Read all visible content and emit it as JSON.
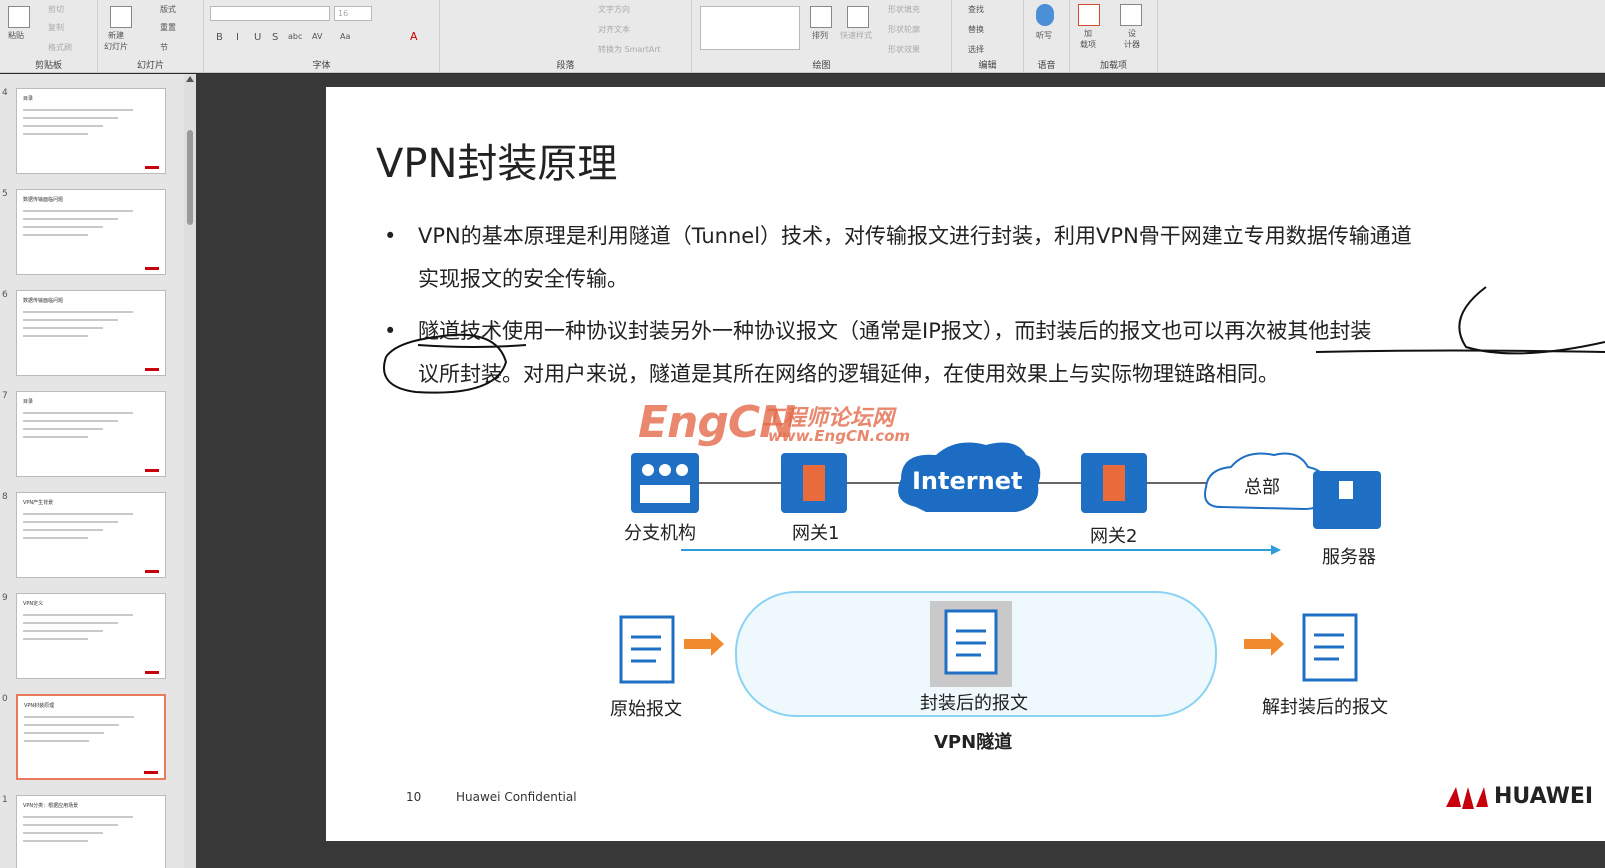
{
  "ribbon": {
    "clipboard": {
      "label": "剪贴板",
      "paste": "粘贴",
      "cut": "剪切",
      "copy": "复制",
      "format_painter": "格式刷"
    },
    "slides": {
      "label": "幻灯片",
      "new_slide": "新建\n幻灯片",
      "layout": "版式",
      "reset": "重置",
      "section": "节"
    },
    "font": {
      "label": "字体",
      "size": "16",
      "bold": "B",
      "italic": "I",
      "underline": "U",
      "strike": "S",
      "shadow": "abc",
      "spacing": "AV",
      "case": "Aa",
      "color": "A"
    },
    "paragraph": {
      "label": "段落",
      "text_direction": "文字方向",
      "align_text": "对齐文本",
      "smartart": "转换为 SmartArt"
    },
    "drawing": {
      "label": "绘图",
      "arrange": "排列",
      "quick_styles": "快速样式",
      "fill": "形状填充",
      "outline": "形状轮廓",
      "effects": "形状效果"
    },
    "editing": {
      "label": "编辑",
      "find": "查找",
      "replace": "替换",
      "select": "选择"
    },
    "voice": {
      "label": "语音",
      "dictate": "听写"
    },
    "addins": {
      "label": "加载项",
      "addin": "加\n载项",
      "designer": "设\n计器"
    }
  },
  "thumbnails": [
    {
      "num": "4",
      "title": "目录"
    },
    {
      "num": "5",
      "title": "数据传输面临问题"
    },
    {
      "num": "6",
      "title": "数据传输面临问题"
    },
    {
      "num": "7",
      "title": "目录"
    },
    {
      "num": "8",
      "title": "VPN产生背景"
    },
    {
      "num": "9",
      "title": "VPN定义"
    },
    {
      "num": "0",
      "title": "VPN封装原理",
      "selected": true
    },
    {
      "num": "1",
      "title": "VPN分类：根据应用场景"
    }
  ],
  "slide": {
    "title": "VPN封装原理",
    "bullets": [
      {
        "line1": "VPN的基本原理是利用隧道（Tunnel）技术，对传输报文进行封装，利用VPN骨干网建立专用数据传输通道",
        "line2": "实现报文的安全传输。"
      },
      {
        "line1": "隧道技术使用一种协议封装另外一种协议报文（通常是IP报文），而封装后的报文也可以再次被其他封装",
        "line2": "议所封装。对用户来说，隧道是其所在网络的逻辑延伸，在使用效果上与实际物理链路相同。"
      }
    ],
    "watermark": {
      "main": "EngCN",
      "cn": "工程师论坛网",
      "url": "www.EngCN.com"
    },
    "diagram": {
      "branch": "分支机构",
      "gw1": "网关1",
      "internet": "Internet",
      "gw2": "网关2",
      "hq": "总部",
      "server": "服务器",
      "original": "原始报文",
      "encapsulated": "封装后的报文",
      "tunnel": "VPN隧道",
      "decapsulated": "解封装后的报文"
    },
    "footer": {
      "page": "10",
      "confidential": "Huawei Confidential",
      "brand": "HUAWEI"
    }
  }
}
